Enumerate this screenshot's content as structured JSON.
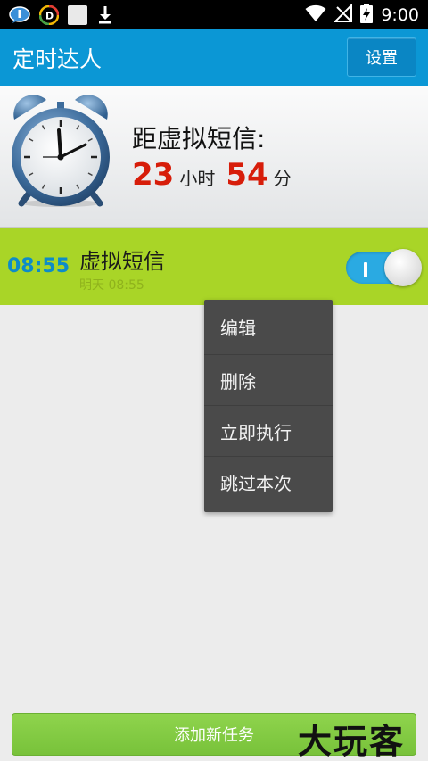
{
  "status_bar": {
    "time": "9:00",
    "left_icons": [
      "message-icon",
      "d-app-icon",
      "blank-app-icon",
      "download-icon"
    ],
    "right_icons": [
      "wifi-icon",
      "no-signal-icon",
      "battery-charging-icon"
    ]
  },
  "app": {
    "title": "定时达人",
    "settings_label": "设置"
  },
  "countdown": {
    "label": "距虚拟短信:",
    "hours": "23",
    "hours_unit": "小时",
    "minutes": "54",
    "minutes_unit": "分"
  },
  "task": {
    "time": "08:55",
    "name": "虚拟短信",
    "next_run": "明天 08:55",
    "enabled": true
  },
  "context_menu": {
    "items": [
      "编辑",
      "删除",
      "立即执行",
      "跳过本次"
    ]
  },
  "add_task_label": "添加新任务",
  "watermark": "大玩客",
  "colors": {
    "title_bar": "#0b97d5",
    "task_row": "#a9d527",
    "countdown_number": "#d71d0a",
    "task_time": "#0d8cc8",
    "add_button": "#7fc93f",
    "menu_bg": "#4a4a4a"
  }
}
